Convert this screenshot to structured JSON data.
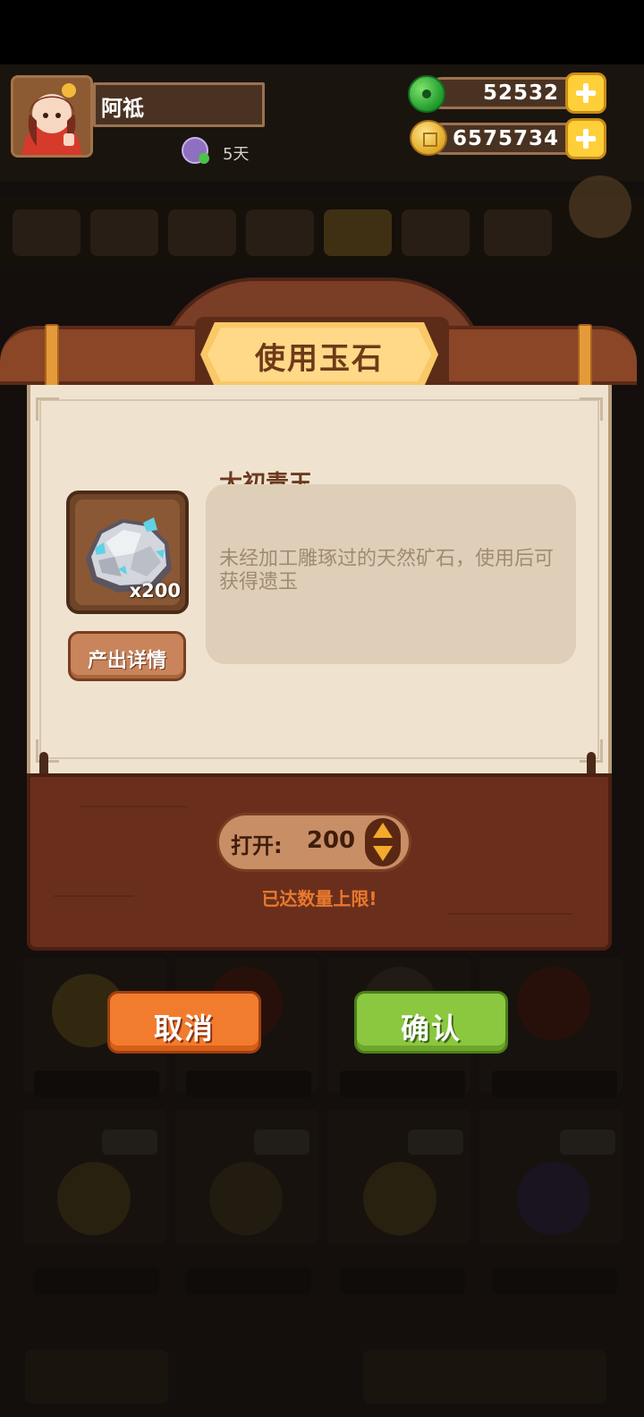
{
  "player": {
    "name": "阿祗",
    "days": "5天"
  },
  "currency": {
    "jade": "52532",
    "coins": "6575734"
  },
  "dialog": {
    "title": "使用玉石",
    "item": {
      "name": "太初青玉",
      "count": "x200",
      "description": "未经加工雕琢过的天然矿石，使用后可获得遗玉",
      "detail_button": "产出详情"
    },
    "open_label": "打开:",
    "open_value": "200",
    "limit_message": "已达数量上限!",
    "cancel_button": "取消",
    "confirm_button": "确认"
  },
  "colors": {
    "title_plate": "#f9c867",
    "cancel": "#f27c2e",
    "confirm": "#8bc840",
    "warning": "#e8792e",
    "paper": "#efe3d0",
    "panel": "#6a2f1c"
  }
}
